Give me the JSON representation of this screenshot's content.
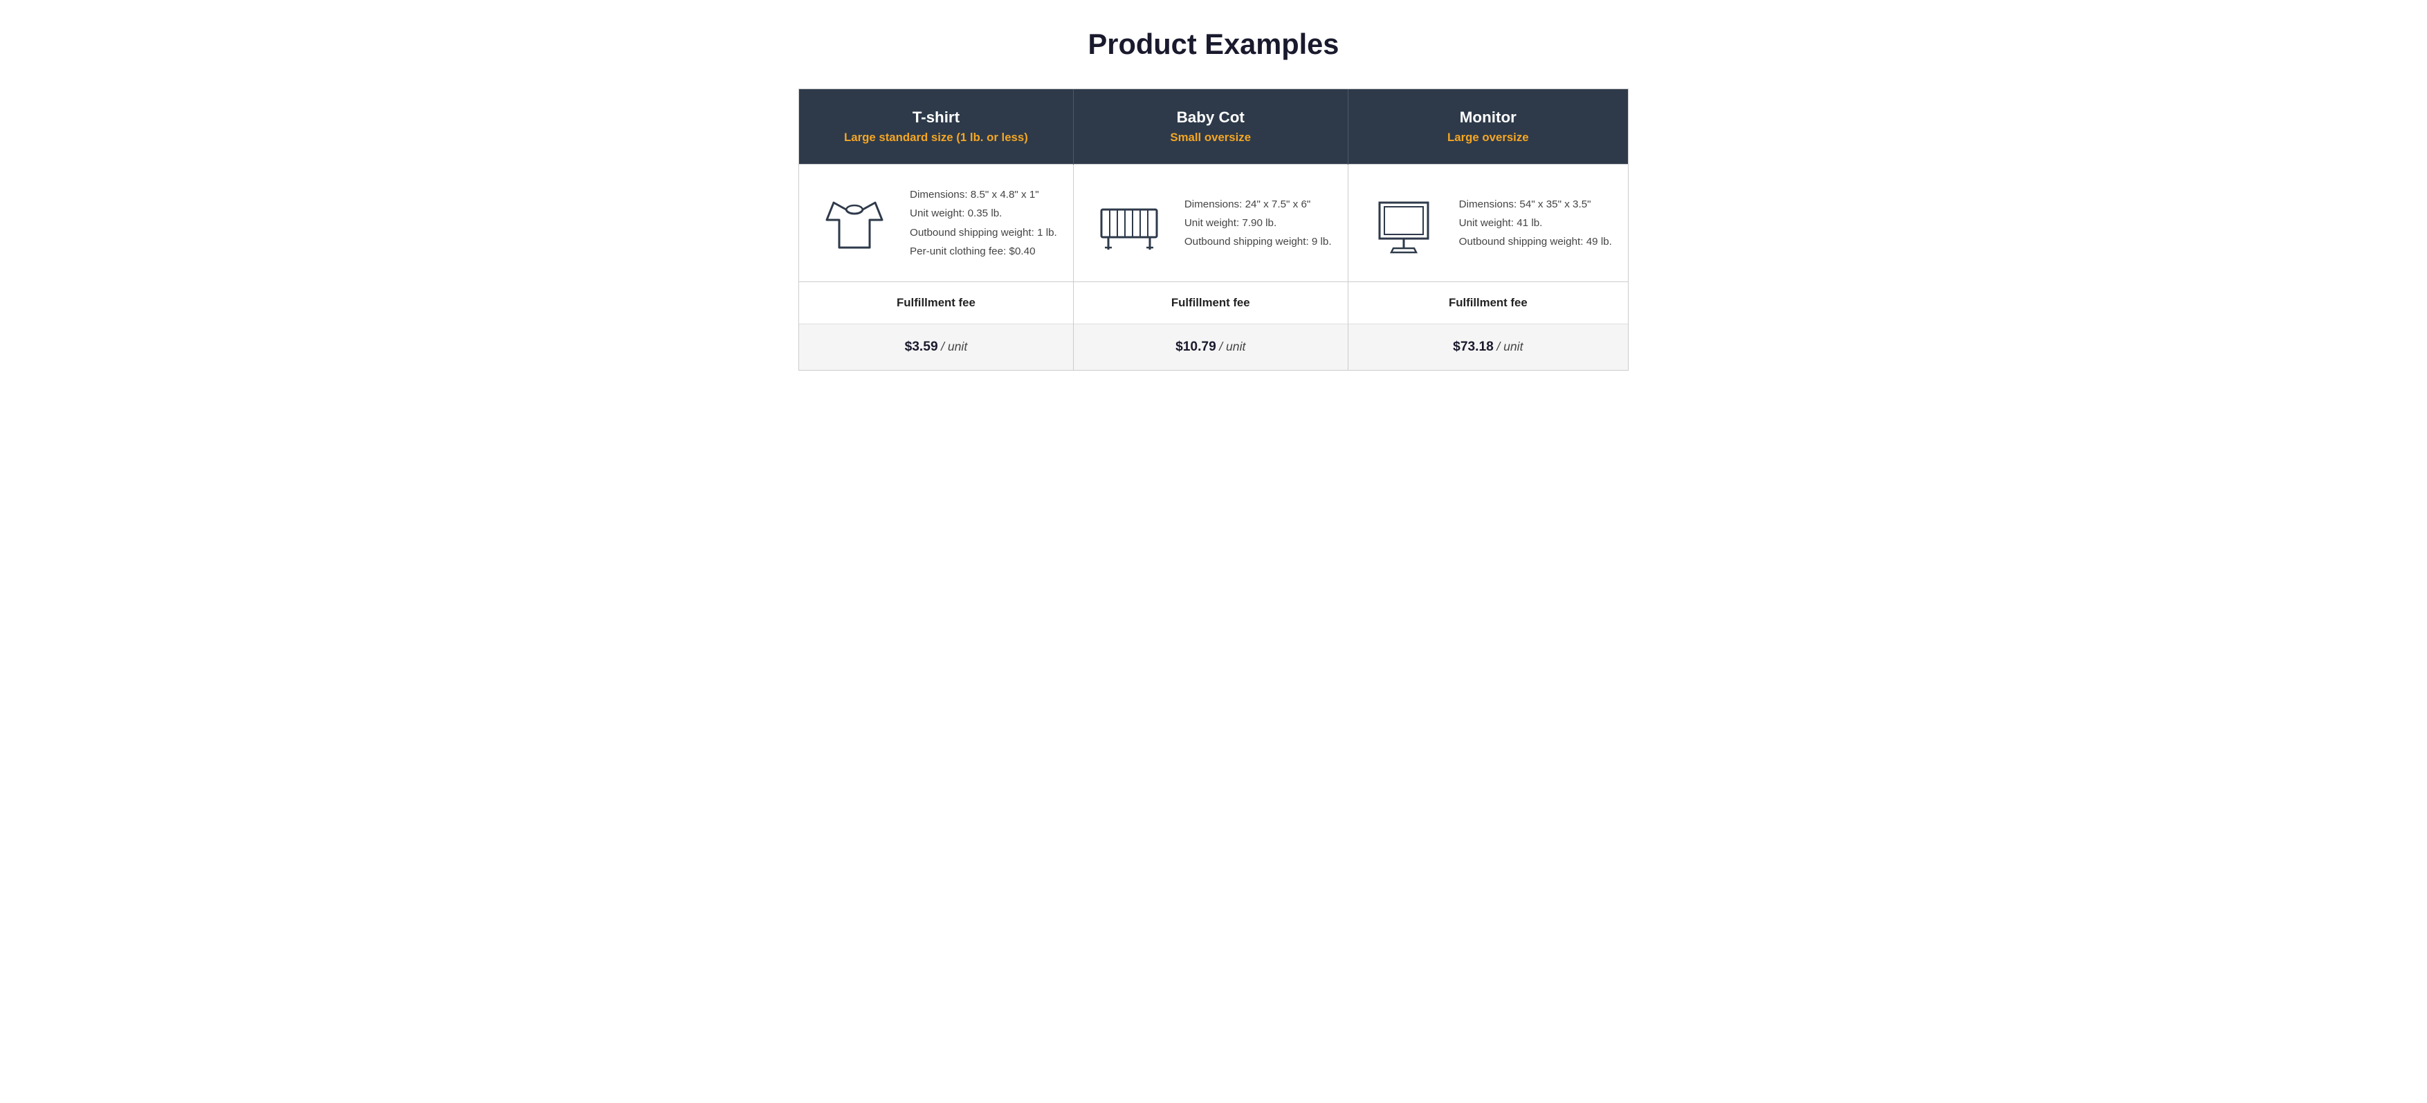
{
  "page": {
    "title": "Product Examples"
  },
  "columns": [
    {
      "product_name": "T-shirt",
      "product_size": "Large standard size (1 lb. or less)",
      "icon": "tshirt-icon",
      "dimensions": "Dimensions: 8.5\" x 4.8\" x 1\"",
      "unit_weight": "Unit weight: 0.35 lb.",
      "outbound_weight": "Outbound shipping weight: 1 lb.",
      "extra_fee": "Per-unit clothing fee: $0.40",
      "fulfillment_label": "Fulfillment fee",
      "price": "$3.59",
      "price_unit": "/ unit"
    },
    {
      "product_name": "Baby Cot",
      "product_size": "Small oversize",
      "icon": "cot-icon",
      "dimensions": "Dimensions: 24\" x 7.5\" x 6\"",
      "unit_weight": "Unit weight: 7.90 lb.",
      "outbound_weight": "Outbound shipping weight: 9 lb.",
      "extra_fee": "",
      "fulfillment_label": "Fulfillment fee",
      "price": "$10.79",
      "price_unit": "/ unit"
    },
    {
      "product_name": "Monitor",
      "product_size": "Large oversize",
      "icon": "monitor-icon",
      "dimensions": "Dimensions: 54\" x 35\" x 3.5\"",
      "unit_weight": "Unit weight: 41 lb.",
      "outbound_weight": "Outbound shipping weight: 49 lb.",
      "extra_fee": "",
      "fulfillment_label": "Fulfillment fee",
      "price": "$73.18",
      "price_unit": "/ unit"
    }
  ]
}
